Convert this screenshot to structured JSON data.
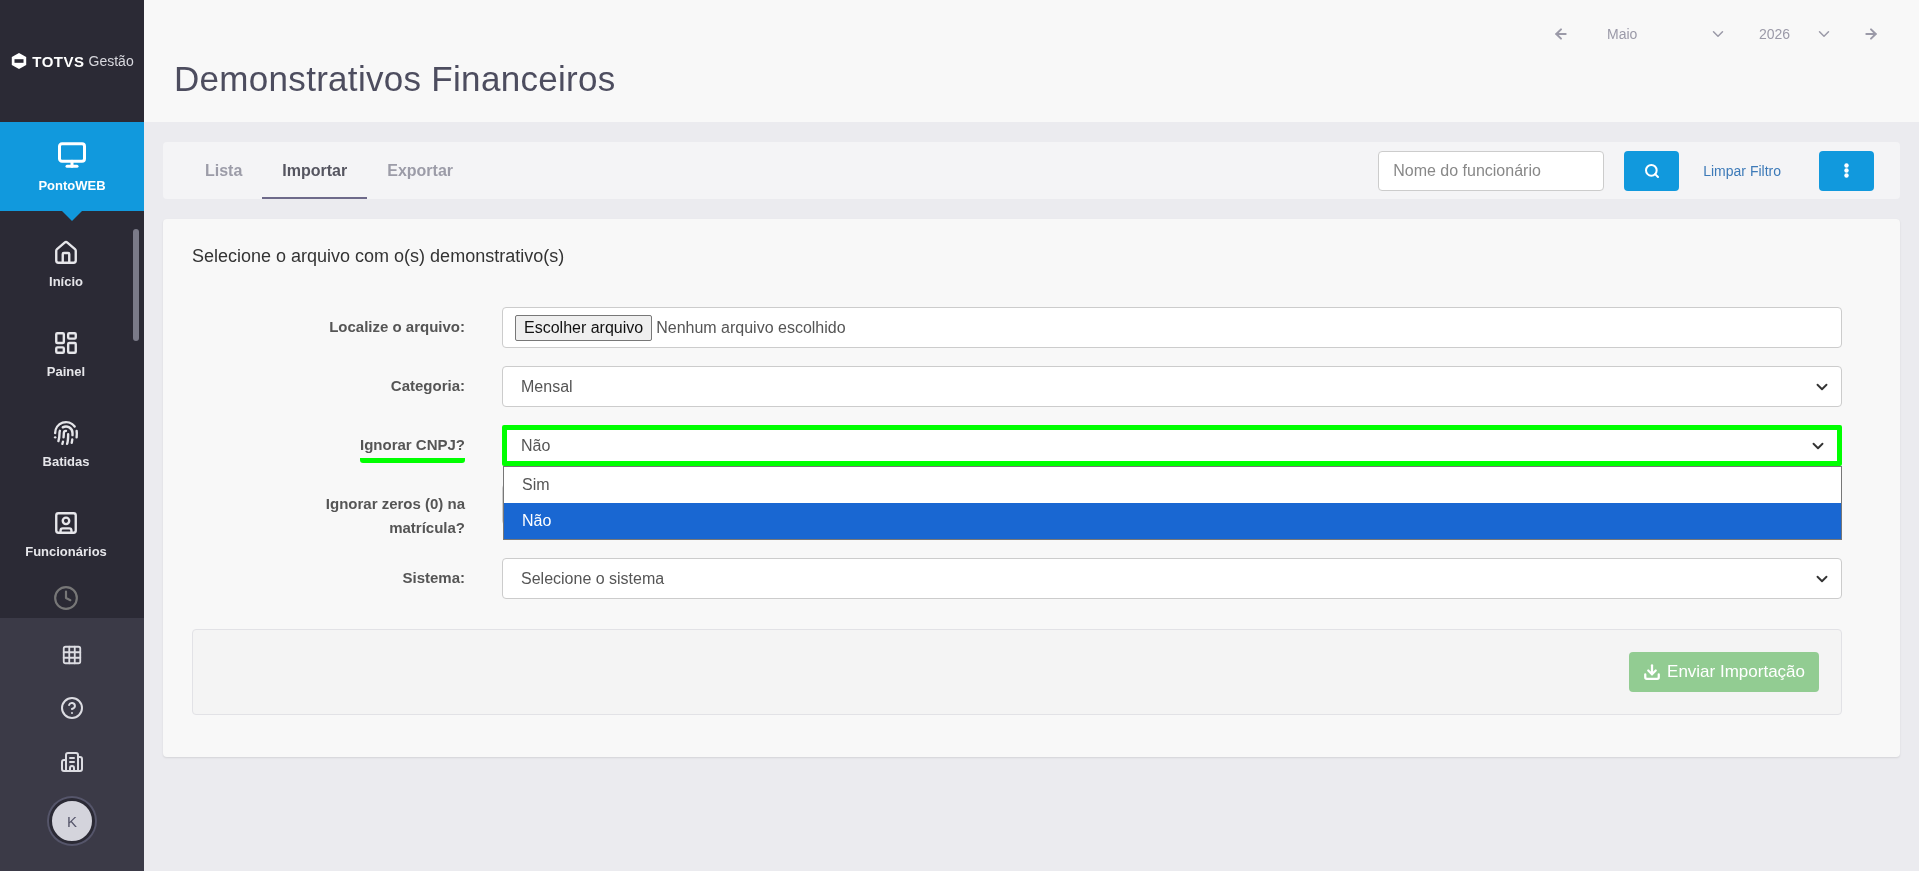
{
  "logo": {
    "brand": "TOTVS",
    "product": "Gestão"
  },
  "sidebar": {
    "items": [
      {
        "label": "PontoWEB",
        "selected": true
      },
      {
        "label": "Início",
        "selected": false
      },
      {
        "label": "Painel",
        "selected": false
      },
      {
        "label": "Batidas",
        "selected": false
      },
      {
        "label": "Funcionários",
        "selected": false
      }
    ],
    "avatar": "K"
  },
  "page_title": "Demonstrativos Financeiros",
  "period": {
    "month": "Maio",
    "year": "2026"
  },
  "tabs": [
    {
      "label": "Lista",
      "selected": false
    },
    {
      "label": "Importar",
      "selected": true
    },
    {
      "label": "Exportar",
      "selected": false
    }
  ],
  "filter": {
    "placeholder": "Nome do funcionário",
    "clear": "Limpar Filtro"
  },
  "form": {
    "heading": "Selecione o arquivo com o(s) demonstrativo(s)",
    "rows": [
      {
        "kind": "file",
        "label": "Localize o arquivo:",
        "button": "Escolher arquivo",
        "value": "Nenhum arquivo escolhido",
        "highlighted": false
      },
      {
        "kind": "select",
        "label": "Categoria:",
        "value": "Mensal",
        "highlighted": false
      },
      {
        "kind": "select",
        "label": "Ignorar CNPJ?",
        "value": "Não",
        "highlighted": true,
        "open": true,
        "options": [
          {
            "label": "Sim",
            "selected": false
          },
          {
            "label": "Não",
            "selected": true
          }
        ]
      },
      {
        "kind": "select",
        "label": "Ignorar zeros (0) na matrícula?",
        "highlighted": false
      },
      {
        "kind": "select",
        "label": "Sistema:",
        "value": "Selecione o sistema",
        "highlighted": false
      }
    ],
    "submit": {
      "label": "Enviar Importação",
      "disabled": true
    }
  }
}
